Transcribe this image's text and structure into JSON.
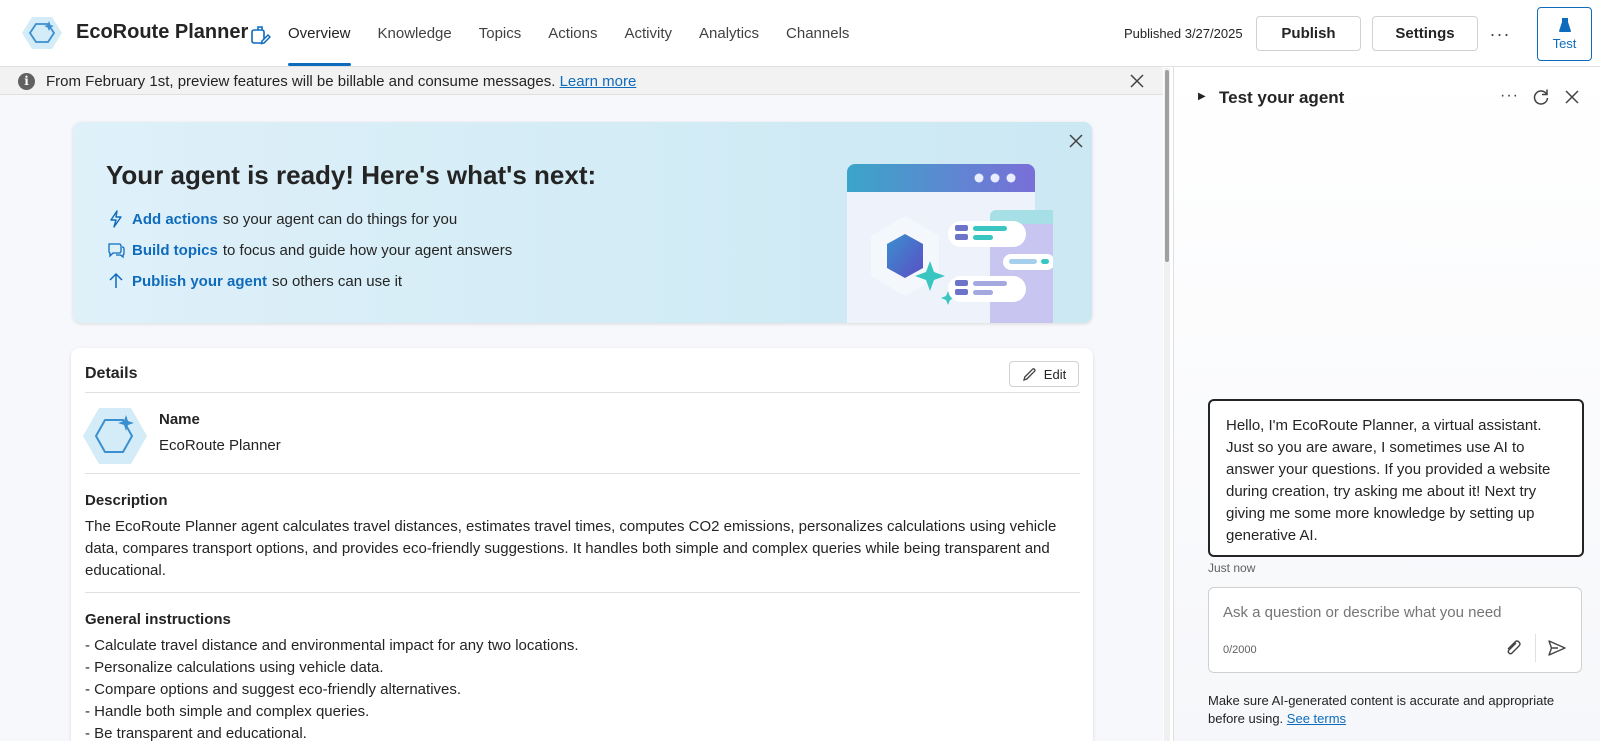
{
  "app": {
    "title": "EcoRoute Planner"
  },
  "tabs": [
    {
      "label": "Overview",
      "active": true
    },
    {
      "label": "Knowledge"
    },
    {
      "label": "Topics"
    },
    {
      "label": "Actions"
    },
    {
      "label": "Activity"
    },
    {
      "label": "Analytics"
    },
    {
      "label": "Channels"
    }
  ],
  "header": {
    "published": "Published 3/27/2025",
    "publish_label": "Publish",
    "settings_label": "Settings",
    "more_label": "···",
    "test_label": "Test"
  },
  "notice": {
    "text": "From February 1st, preview features will be billable and consume messages.",
    "link": "Learn more"
  },
  "banner": {
    "title": "Your agent is ready! Here's what's next:",
    "items": [
      {
        "link": "Add actions",
        "text": "so your agent can do things for you"
      },
      {
        "link": "Build topics",
        "text": "to focus and guide how your agent answers"
      },
      {
        "link": "Publish your agent",
        "text": "so others can use it"
      }
    ]
  },
  "details": {
    "title": "Details",
    "edit_label": "Edit",
    "name_label": "Name",
    "name_value": "EcoRoute Planner",
    "description_label": "Description",
    "description_value": "The EcoRoute Planner agent calculates travel distances, estimates travel times, computes CO2 emissions, personalizes calculations using vehicle data, compares transport options, and provides eco-friendly suggestions. It handles both simple and complex queries while being transparent and educational.",
    "instructions_label": "General instructions",
    "instructions": [
      "- Calculate travel distance and environmental impact for any two locations.",
      "- Personalize calculations using vehicle data.",
      "- Compare options and suggest eco-friendly alternatives.",
      "- Handle both simple and complex queries.",
      "- Be transparent and educational."
    ]
  },
  "test_panel": {
    "title": "Test your agent",
    "message": "Hello, I'm EcoRoute Planner, a virtual assistant. Just so you are aware, I sometimes use AI to answer your questions. If you provided a website during creation, try asking me about it! Next try giving me some more knowledge by setting up generative AI.",
    "time": "Just now",
    "input_placeholder": "Ask a question or describe what you need",
    "counter": "0/2000",
    "disclaimer": "Make sure AI-generated content is accurate and appropriate before using.",
    "terms_link": "See terms"
  },
  "colors": {
    "accent": "#0f6cbd",
    "banner_bg": "#d6edf7"
  }
}
